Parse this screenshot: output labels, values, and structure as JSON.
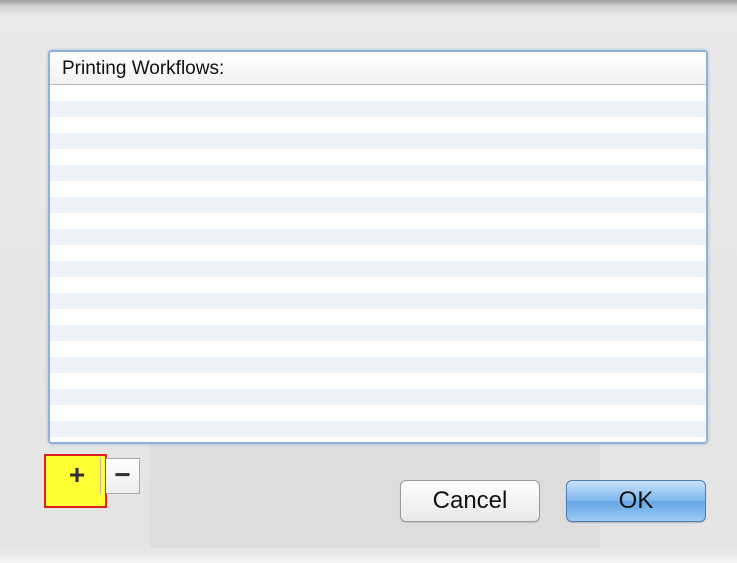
{
  "dialog": {
    "list_header": "Printing Workflows:",
    "rows": [
      "",
      "",
      "",
      "",
      "",
      "",
      "",
      "",
      "",
      "",
      ""
    ]
  },
  "buttons": {
    "add_label": "+",
    "remove_label": "−",
    "cancel_label": "Cancel",
    "ok_label": "OK"
  },
  "colors": {
    "default_button": "#64a5e6",
    "highlight_fill": "#ffff33",
    "highlight_border": "#e02020",
    "focus_ring": "#8fb3d8"
  }
}
